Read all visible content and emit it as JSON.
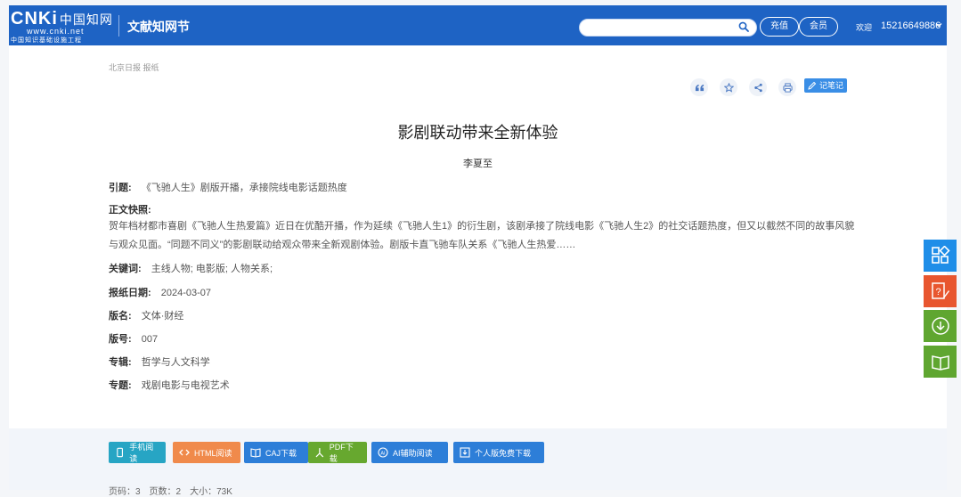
{
  "header": {
    "logo_text": "CNKi",
    "logo_cn": "中国知网",
    "logo_url": "www.cnki.net",
    "logo_sub": "中国知识基础设施工程",
    "section_title": "文献知网节",
    "search": {
      "value": "",
      "placeholder": ""
    },
    "recharge_label": "充值",
    "member_label": "会员",
    "welcome_label": "欢迎",
    "username": "15216649886",
    "accent": "#1e63c4"
  },
  "breadcrumb": "北京日报 报纸",
  "toolbar": {
    "icons": [
      "quote-icon",
      "star-icon",
      "share-icon",
      "print-icon"
    ],
    "note_label": "记笔记"
  },
  "article": {
    "title": "影剧联动带来全新体验",
    "author": "李夏至",
    "lead_label": "引题:",
    "lead_value": "《飞驰人生》剧版开播，承接院线电影话题热度",
    "summary_label": "正文快照:",
    "summary_text": "贺年档材都市喜剧《飞驰人生热爱篇》近日在优酷开播，作为延续《飞驰人生1》的衍生剧，该剧承接了院线电影《飞驰人生2》的社交话题热度，但又以截然不同的故事风貌与观众见面。“同题不同义”的影剧联动给观众带来全新观剧体验。剧版卡直飞驰车队关系《飞驰人生热爱……",
    "keywords_label": "关键词:",
    "keywords_value": "主线人物; 电影版; 人物关系;",
    "date_label": "报纸日期:",
    "date_value": "2024-03-07",
    "edition_name_label": "版名:",
    "edition_name_value": "文体·财经",
    "edition_no_label": "版号:",
    "edition_no_value": "007",
    "series_label": "专辑:",
    "series_value": "哲学与人文科学",
    "topic_label": "专题:",
    "topic_value": "戏剧电影与电视艺术"
  },
  "actions": {
    "mobile_label": "手机阅读",
    "html_label": "HTML阅读",
    "caj_label": "CAJ下载",
    "pdf_label": "PDF下载",
    "ai_label": "AI辅助阅读",
    "download_label": "个人版免费下载",
    "page_stats": "页码：3　页数：2　大小：73K"
  },
  "sidebar": {
    "icons": [
      "grid-icon",
      "feedback-icon",
      "download-icon",
      "book-icon"
    ],
    "colors": [
      "#1f8ee8",
      "#e8562f",
      "#5fa630",
      "#5fa630"
    ]
  }
}
